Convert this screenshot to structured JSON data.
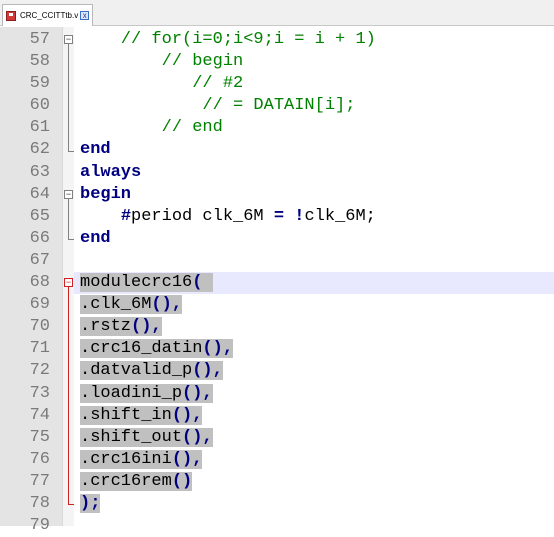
{
  "tab": {
    "label": "CRC_CCITTtb.v",
    "close": "x"
  },
  "lines": [
    {
      "num": "57",
      "segments": [
        {
          "t": "    // for(i=0;i<9;i = i + 1)",
          "c": "cmt"
        }
      ]
    },
    {
      "num": "58",
      "segments": [
        {
          "t": "        // begin",
          "c": "cmt"
        }
      ]
    },
    {
      "num": "59",
      "segments": [
        {
          "t": "           // #2",
          "c": "cmt"
        }
      ]
    },
    {
      "num": "60",
      "segments": [
        {
          "t": "            // = DATAIN[i];",
          "c": "cmt"
        }
      ]
    },
    {
      "num": "61",
      "segments": [
        {
          "t": "        // end",
          "c": "cmt"
        }
      ]
    },
    {
      "num": "62",
      "segments": [
        {
          "t": "end",
          "c": "kw"
        }
      ]
    },
    {
      "num": "63",
      "segments": [
        {
          "t": "always",
          "c": "kw"
        }
      ]
    },
    {
      "num": "64",
      "segments": [
        {
          "t": "begin",
          "c": "kw"
        }
      ]
    },
    {
      "num": "65",
      "segments": [
        {
          "t": "    ",
          "c": ""
        },
        {
          "t": "#",
          "c": "op"
        },
        {
          "t": "period clk_6M ",
          "c": ""
        },
        {
          "t": "=",
          "c": "op"
        },
        {
          "t": " ",
          "c": ""
        },
        {
          "t": "!",
          "c": "op"
        },
        {
          "t": "clk_6M;",
          "c": ""
        }
      ]
    },
    {
      "num": "66",
      "segments": [
        {
          "t": "end",
          "c": "kw"
        }
      ]
    },
    {
      "num": "67",
      "segments": []
    },
    {
      "num": "68",
      "sel": true,
      "segments": [
        {
          "t": "modulecrc16",
          "c": ""
        },
        {
          "t": "(",
          "c": "op"
        },
        {
          "t": " ",
          "c": ""
        }
      ]
    },
    {
      "num": "69",
      "sel": true,
      "segments": [
        {
          "t": ".clk_6M",
          "c": ""
        },
        {
          "t": "(),",
          "c": "op"
        }
      ]
    },
    {
      "num": "70",
      "sel": true,
      "segments": [
        {
          "t": ".rstz",
          "c": ""
        },
        {
          "t": "(),",
          "c": "op"
        }
      ]
    },
    {
      "num": "71",
      "sel": true,
      "segments": [
        {
          "t": ".crc16_datin",
          "c": ""
        },
        {
          "t": "(),",
          "c": "op"
        }
      ]
    },
    {
      "num": "72",
      "sel": true,
      "segments": [
        {
          "t": ".datvalid_p",
          "c": ""
        },
        {
          "t": "(),",
          "c": "op"
        }
      ]
    },
    {
      "num": "73",
      "sel": true,
      "segments": [
        {
          "t": ".loadini_p",
          "c": ""
        },
        {
          "t": "(),",
          "c": "op"
        }
      ]
    },
    {
      "num": "74",
      "sel": true,
      "segments": [
        {
          "t": ".shift_in",
          "c": ""
        },
        {
          "t": "(),",
          "c": "op"
        }
      ]
    },
    {
      "num": "75",
      "sel": true,
      "segments": [
        {
          "t": ".shift_out",
          "c": ""
        },
        {
          "t": "(),",
          "c": "op"
        }
      ]
    },
    {
      "num": "76",
      "sel": true,
      "segments": [
        {
          "t": ".crc16ini",
          "c": ""
        },
        {
          "t": "(),",
          "c": "op"
        }
      ]
    },
    {
      "num": "77",
      "sel": true,
      "segments": [
        {
          "t": ".crc16rem",
          "c": ""
        },
        {
          "t": "()",
          "c": "op"
        }
      ]
    },
    {
      "num": "78",
      "sel": true,
      "segments": [
        {
          "t": ");",
          "c": "op"
        }
      ]
    },
    {
      "num": "79",
      "segments": []
    }
  ],
  "colors": {
    "comment": "#008000",
    "keyword": "#000080",
    "selection": "#c0c0c0",
    "current_line": "#e8e8ff",
    "fold_active": "#d02020"
  }
}
